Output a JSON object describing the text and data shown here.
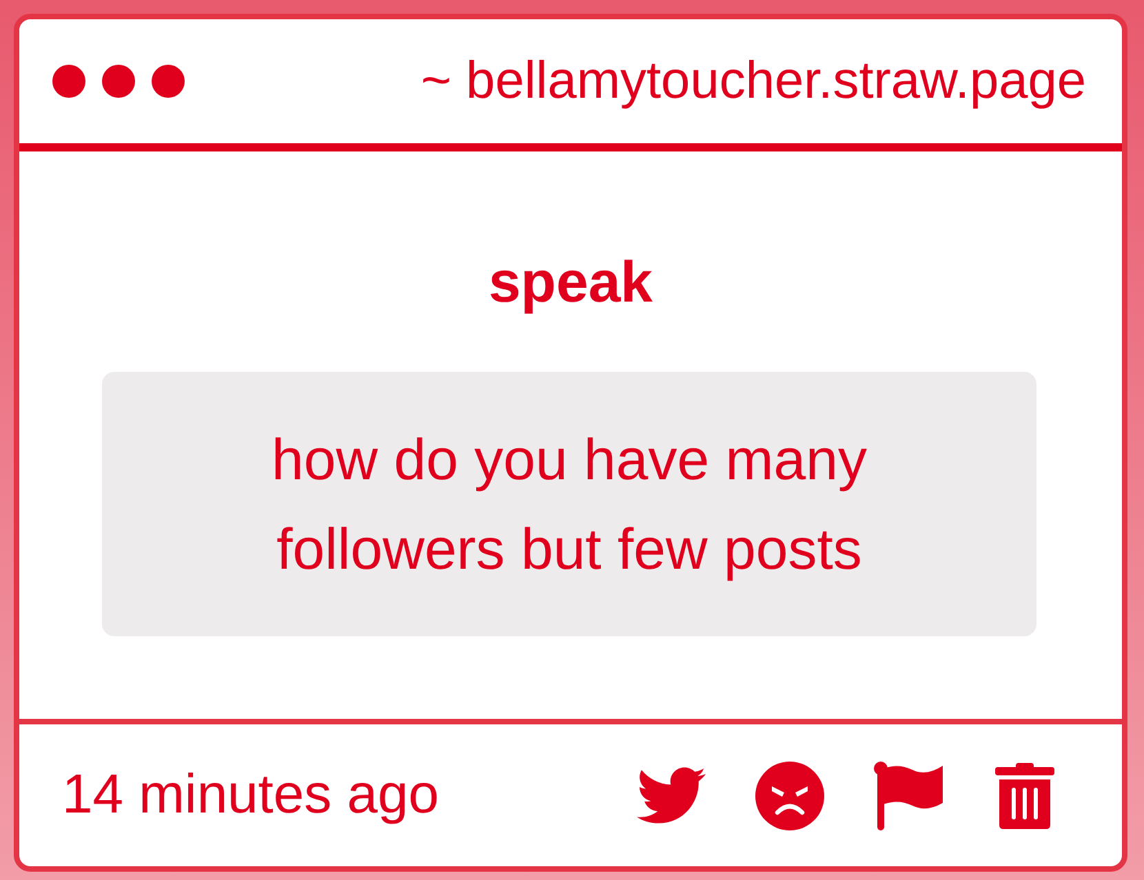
{
  "header": {
    "url": "~ bellamytoucher.straw.page"
  },
  "title": "speak",
  "message": "how do you have many followers but few posts",
  "footer": {
    "timestamp": "14 minutes ago"
  }
}
